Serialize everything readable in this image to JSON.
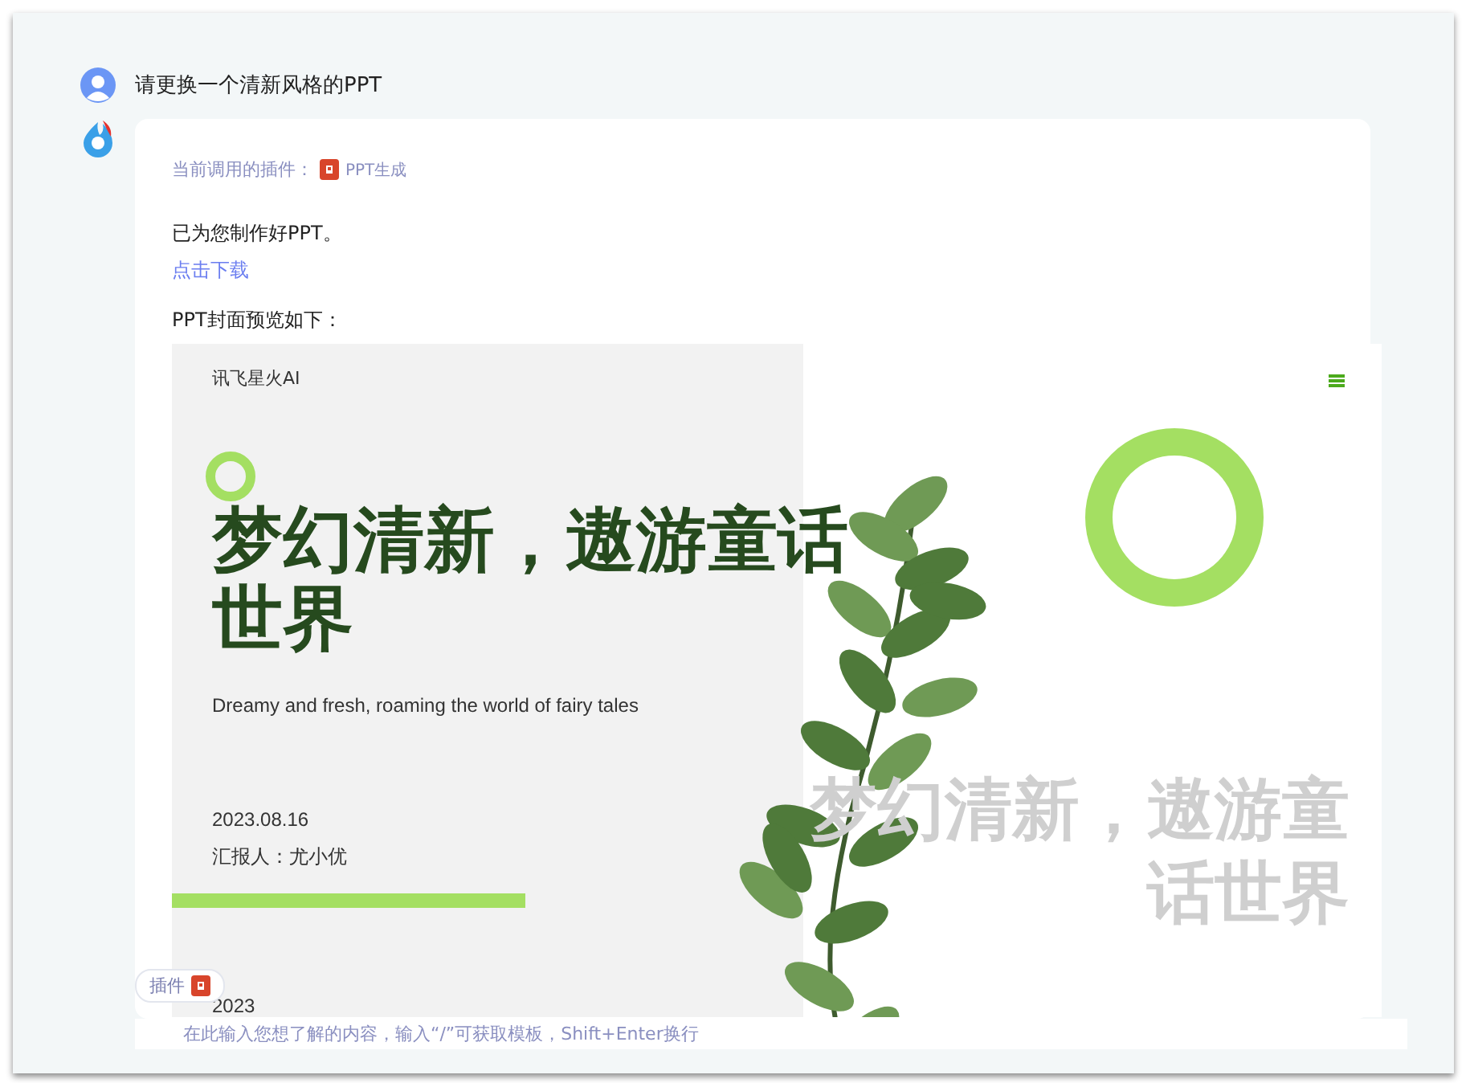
{
  "user_message": {
    "text": "请更换一个清新风格的PPT"
  },
  "reply": {
    "plugin_label": "当前调用的插件：",
    "plugin_name": "PPT生成",
    "message": "已为您制作好PPT。",
    "download_link": "点击下载",
    "preview_label": "PPT封面预览如下：",
    "slide": {
      "brand": "讯飞星火AI",
      "title": "梦幻清新，遨游童话世界",
      "subtitle": "Dreamy and fresh, roaming the world of fairy tales",
      "date": "2023.08.16",
      "reporter": "汇报人：尤小优",
      "year": "2023",
      "background_title": "梦幻清新，遨游童话世界"
    }
  },
  "input": {
    "plugin_button": "插件",
    "placeholder": "在此输入您想了解的内容，输入“/”可获取模板，Shift+Enter换行"
  }
}
